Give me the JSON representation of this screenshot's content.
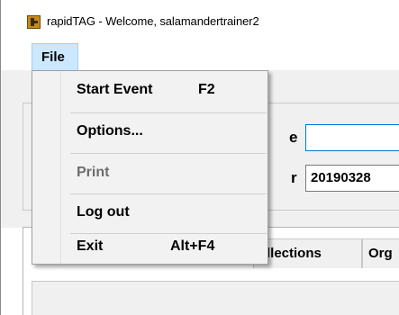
{
  "window": {
    "title": "rapidTAG - Welcome, salamandertrainer2",
    "icon": "rapidtag-app-icon"
  },
  "menubar": {
    "file_label": "File"
  },
  "file_menu": {
    "items": [
      {
        "label": "Start Event",
        "shortcut": "F2",
        "enabled": true
      },
      {
        "label": "Options...",
        "shortcut": "",
        "enabled": true
      },
      {
        "label": "Print",
        "shortcut": "",
        "enabled": false
      },
      {
        "label": "Log out",
        "shortcut": "",
        "enabled": true
      },
      {
        "label": "Exit",
        "shortcut": "Alt+F4",
        "enabled": true
      }
    ]
  },
  "form": {
    "name_label_partial": "e",
    "name_value": "",
    "date_label_partial": "r",
    "date_value": "20190328"
  },
  "tabs": {
    "collections_partial": "llections",
    "org_partial": "Org"
  },
  "colors": {
    "menu_highlight": "#cce8ff",
    "menu_highlight_border": "#99d1ff",
    "disabled_text": "#6d6d6d",
    "focus_border": "#0078d7"
  }
}
